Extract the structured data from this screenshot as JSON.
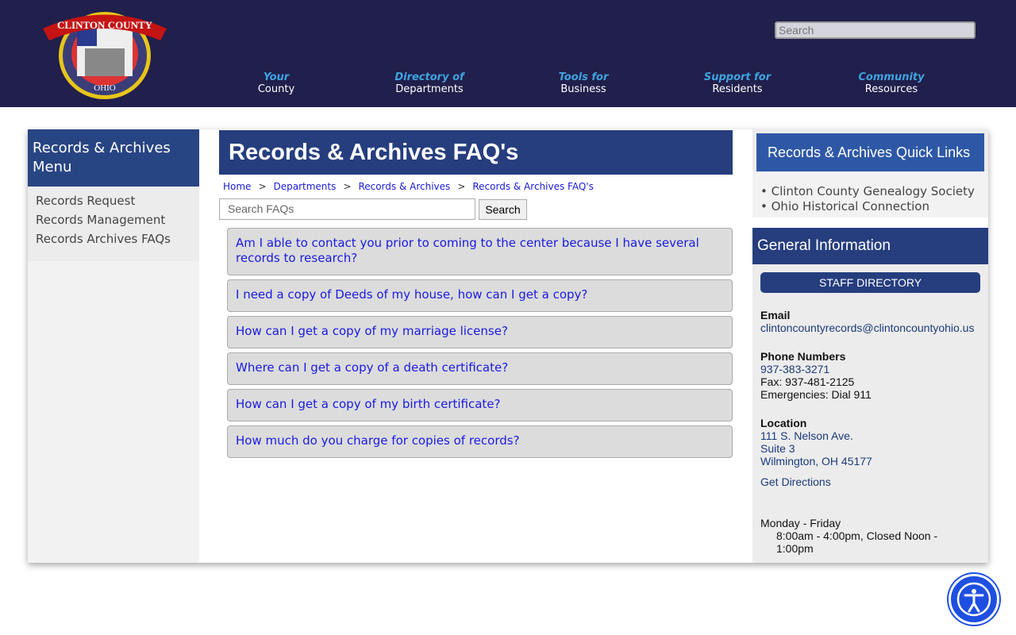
{
  "header": {
    "logo_text": "CLINTON COUNTY OHIO 1810",
    "search_placeholder": "Search",
    "nav": [
      {
        "a": "Your",
        "b": "County"
      },
      {
        "a": "Directory of",
        "b": "Departments"
      },
      {
        "a": "Tools for",
        "b": "Business"
      },
      {
        "a": "Support for",
        "b": "Residents"
      },
      {
        "a": "Community",
        "b": "Resources"
      }
    ]
  },
  "left_menu": {
    "title": "Records & Archives Menu",
    "items": [
      "Records Request",
      "Records Management",
      "Records Archives FAQs"
    ]
  },
  "main": {
    "title": "Records & Archives FAQ's",
    "breadcrumb": [
      "Home",
      "Departments",
      "Records & Archives",
      "Records & Archives FAQ's"
    ],
    "separator": ">",
    "search_placeholder": "Search FAQs",
    "search_button": "Search",
    "faqs": [
      "Am I able to contact you prior to coming to the center because I have several records to research?",
      "I need a copy of Deeds of my house, how can I get a copy?",
      "How can I get a copy of my marriage license?",
      "Where can I get a copy of a death certificate?",
      "How can I get a copy of my birth certificate?",
      "How much do you charge for copies of records?"
    ]
  },
  "right": {
    "quick_links_title": "Records & Archives Quick Links",
    "quick_links": [
      "Clinton County Genealogy Society",
      "Ohio Historical Connection"
    ],
    "general_title": "General Information",
    "staff_button": "STAFF DIRECTORY",
    "email_label": "Email",
    "email": "clintoncountyrecords@clintoncountyohio.us",
    "phone_label": "Phone Numbers",
    "phone": "937-383-3271",
    "fax": "Fax: 937-481-2125",
    "emergency": "Emergencies: Dial 911",
    "location_label": "Location",
    "address1": "111 S. Nelson Ave.",
    "address2": "Suite 3",
    "address3": "Wilmington, OH 45177",
    "directions": "Get Directions",
    "hours_days": "Monday - Friday",
    "hours": "8:00am - 4:00pm, Closed Noon - 1:00pm"
  },
  "accessibility_icon": "accessibility-icon"
}
